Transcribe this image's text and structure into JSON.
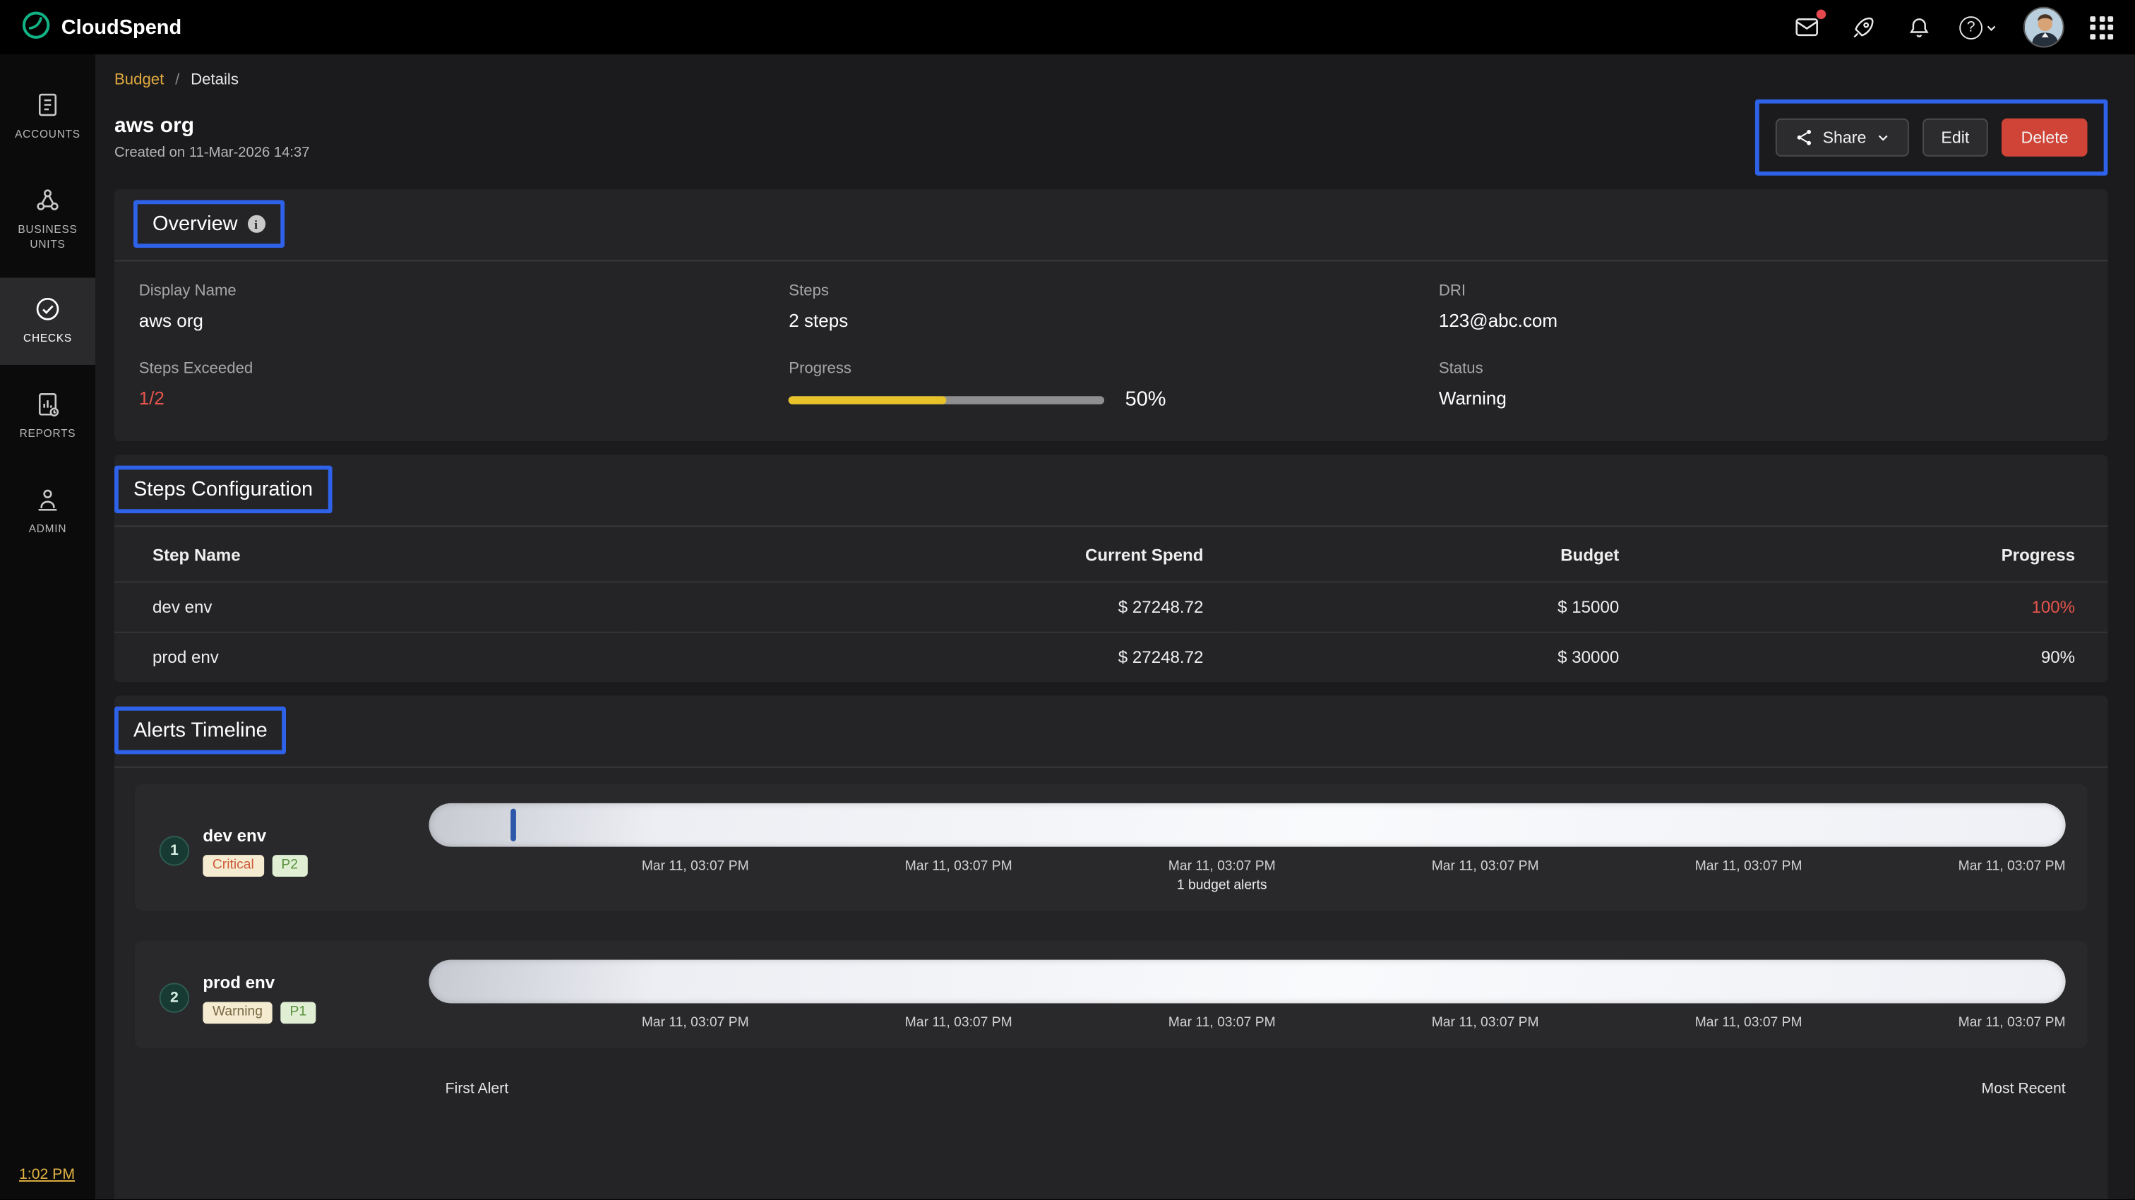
{
  "topbar": {
    "brand": "CloudSpend",
    "icons": [
      "feedback-icon",
      "rocket-icon",
      "bell-icon",
      "help-icon",
      "user-avatar",
      "apps-grid-icon"
    ]
  },
  "sidebar": {
    "items": [
      {
        "label": "ACCOUNTS",
        "icon": "accounts-icon",
        "active": false
      },
      {
        "label": "BUSINESS UNITS",
        "icon": "business-units-icon",
        "active": false
      },
      {
        "label": "CHECKS",
        "icon": "checks-icon",
        "active": true
      },
      {
        "label": "REPORTS",
        "icon": "reports-icon",
        "active": false
      },
      {
        "label": "ADMIN",
        "icon": "admin-icon",
        "active": false
      }
    ],
    "time": "1:02 PM"
  },
  "breadcrumb": {
    "parent": "Budget",
    "separator": "/",
    "current": "Details"
  },
  "header": {
    "title": "aws org",
    "created": "Created on 11-Mar-2026 14:37",
    "share_label": "Share",
    "edit_label": "Edit",
    "delete_label": "Delete"
  },
  "overview": {
    "title": "Overview",
    "progress_percent": 50,
    "fields": [
      {
        "label": "Display Name",
        "value": "aws org"
      },
      {
        "label": "Steps",
        "value": "2 steps"
      },
      {
        "label": "DRI",
        "value": "123@abc.com"
      },
      {
        "label": "Steps Exceeded",
        "value": "1/2"
      },
      {
        "label": "Progress",
        "value": "50%"
      },
      {
        "label": "Status",
        "value": "Warning"
      }
    ]
  },
  "steps_config": {
    "title": "Steps Configuration",
    "columns": [
      "Step Name",
      "Current Spend",
      "Budget",
      "Progress"
    ],
    "rows": [
      {
        "name": "dev env",
        "current_spend": "$ 27248.72",
        "budget": "$ 15000",
        "progress": "100%",
        "exceeded": true
      },
      {
        "name": "prod env",
        "current_spend": "$ 27248.72",
        "budget": "$ 30000",
        "progress": "90%",
        "exceeded": false
      }
    ]
  },
  "alerts": {
    "title": "Alerts Timeline",
    "footer_left": "First Alert",
    "footer_right": "Most Recent",
    "rows": [
      {
        "index": "1",
        "name": "dev env",
        "tags": [
          {
            "label": "Critical",
            "type": "critical"
          },
          {
            "label": "P2",
            "type": "priority"
          }
        ],
        "marker_position_pct": 5,
        "note": "1 budget alerts",
        "dates": [
          "Mar 11, 03:07 PM",
          "Mar 11, 03:07 PM",
          "Mar 11, 03:07 PM",
          "Mar 11, 03:07 PM",
          "Mar 11, 03:07 PM",
          "Mar 11, 03:07 PM"
        ]
      },
      {
        "index": "2",
        "name": "prod env",
        "tags": [
          {
            "label": "Warning",
            "type": "warning"
          },
          {
            "label": "P1",
            "type": "priority"
          }
        ],
        "dates": [
          "Mar 11, 03:07 PM",
          "Mar 11, 03:07 PM",
          "Mar 11, 03:07 PM",
          "Mar 11, 03:07 PM",
          "Mar 11, 03:07 PM",
          "Mar 11, 03:07 PM"
        ]
      }
    ]
  },
  "colors": {
    "accent_yellow": "#E3B341",
    "progress_fill": "#E8C229",
    "danger_red": "#D04437",
    "annotation_blue": "#2E62E9",
    "brand_teal": "#11B384"
  }
}
